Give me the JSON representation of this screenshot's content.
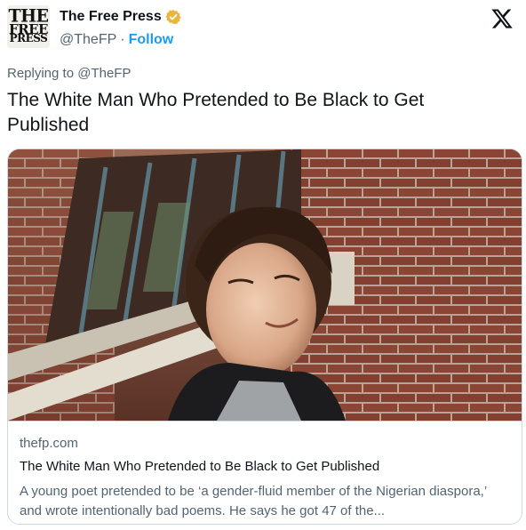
{
  "author": {
    "avatar_text": [
      "THE",
      "FREE",
      "PRESS"
    ],
    "display_name": "The Free Press",
    "handle": "@TheFP",
    "separator": "·",
    "follow_label": "Follow",
    "verified_badge_color": "#e8b63c"
  },
  "platform_icon": "x-logo-icon",
  "reply": {
    "prefix": "Replying to",
    "mention": "@TheFP"
  },
  "tweet": {
    "text": "The White Man Who Pretended to Be Black to Get Published"
  },
  "link_card": {
    "domain": "thefp.com",
    "title": "The White Man Who Pretended to Be Black to Get Published",
    "description": "A young poet pretended to be ‘a gender-fluid member of the Nigerian diaspora,’ and wrote intentionally bad poems. He says he got 47 of the..."
  },
  "colors": {
    "text": "#0f1419",
    "secondary": "#536471",
    "accent": "#1d9bf0",
    "border": "#cfd9de"
  }
}
